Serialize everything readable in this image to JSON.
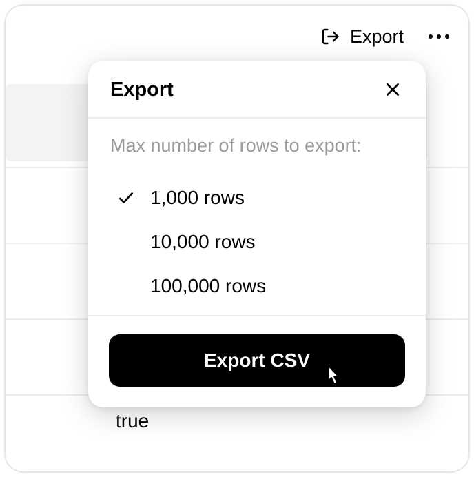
{
  "topbar": {
    "export_label": "Export"
  },
  "background": {
    "cell_value": "true"
  },
  "dialog": {
    "title": "Export",
    "prompt": "Max number of rows to export:",
    "options": [
      {
        "label": "1,000 rows",
        "selected": true
      },
      {
        "label": "10,000 rows",
        "selected": false
      },
      {
        "label": "100,000 rows",
        "selected": false
      }
    ],
    "submit_label": "Export CSV"
  }
}
